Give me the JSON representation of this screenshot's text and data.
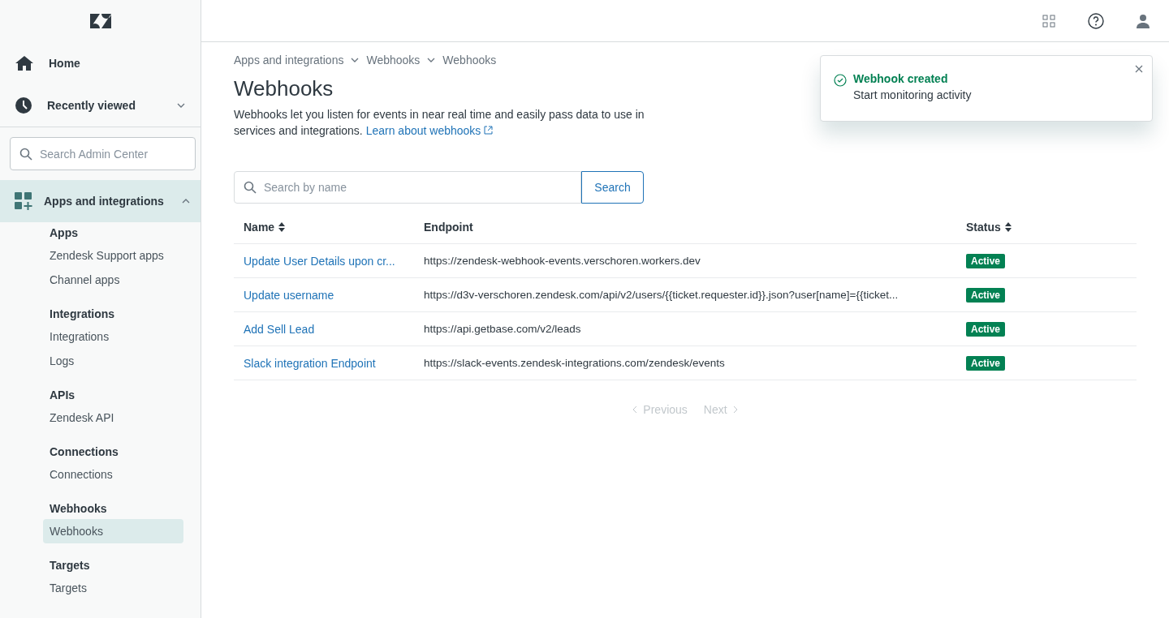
{
  "sidebar": {
    "nav": [
      {
        "label": "Home",
        "kind": "home"
      },
      {
        "label": "Recently viewed",
        "kind": "recent",
        "expanded": false
      }
    ],
    "search": {
      "placeholder": "Search Admin Center"
    },
    "section": {
      "label": "Apps and integrations",
      "expanded": true,
      "selected": true
    },
    "groups": [
      {
        "heading": "Apps",
        "items": [
          {
            "label": "Zendesk Support apps",
            "selected": false
          },
          {
            "label": "Channel apps",
            "selected": false
          }
        ]
      },
      {
        "heading": "Integrations",
        "items": [
          {
            "label": "Integrations",
            "selected": false
          },
          {
            "label": "Logs",
            "selected": false
          }
        ]
      },
      {
        "heading": "APIs",
        "items": [
          {
            "label": "Zendesk API",
            "selected": false
          }
        ]
      },
      {
        "heading": "Connections",
        "items": [
          {
            "label": "Connections",
            "selected": false
          }
        ]
      },
      {
        "heading": "Webhooks",
        "items": [
          {
            "label": "Webhooks",
            "selected": true
          }
        ]
      },
      {
        "heading": "Targets",
        "items": [
          {
            "label": "Targets",
            "selected": false
          }
        ]
      }
    ]
  },
  "breadcrumb": [
    "Apps and integrations",
    "Webhooks",
    "Webhooks"
  ],
  "title": "Webhooks",
  "description": "Webhooks let you listen for events in near real time and easily pass data to use in services and integrations.",
  "learn_link": "Learn about webhooks",
  "search": {
    "placeholder": "Search by name",
    "button": "Search"
  },
  "table": {
    "columns": [
      {
        "label": "Name",
        "sortable": true
      },
      {
        "label": "Endpoint",
        "sortable": false
      },
      {
        "label": "Status",
        "sortable": true
      }
    ],
    "rows": [
      {
        "name": "Update User Details upon cr...",
        "endpoint": "https://zendesk-webhook-events.verschoren.workers.dev",
        "status": "Active"
      },
      {
        "name": "Update username",
        "endpoint": "https://d3v-verschoren.zendesk.com/api/v2/users/{{ticket.requester.id}}.json?user[name]={{ticket...",
        "status": "Active"
      },
      {
        "name": "Add Sell Lead",
        "endpoint": "https://api.getbase.com/v2/leads",
        "status": "Active"
      },
      {
        "name": "Slack integration Endpoint",
        "endpoint": "https://slack-events.zendesk-integrations.com/zendesk/events",
        "status": "Active"
      }
    ]
  },
  "pagination": [
    {
      "label": "Previous",
      "kind": "prev",
      "disabled": true
    },
    {
      "label": "Next",
      "kind": "next",
      "disabled": true
    }
  ],
  "toast": {
    "title": "Webhook created",
    "message": "Start monitoring activity"
  }
}
